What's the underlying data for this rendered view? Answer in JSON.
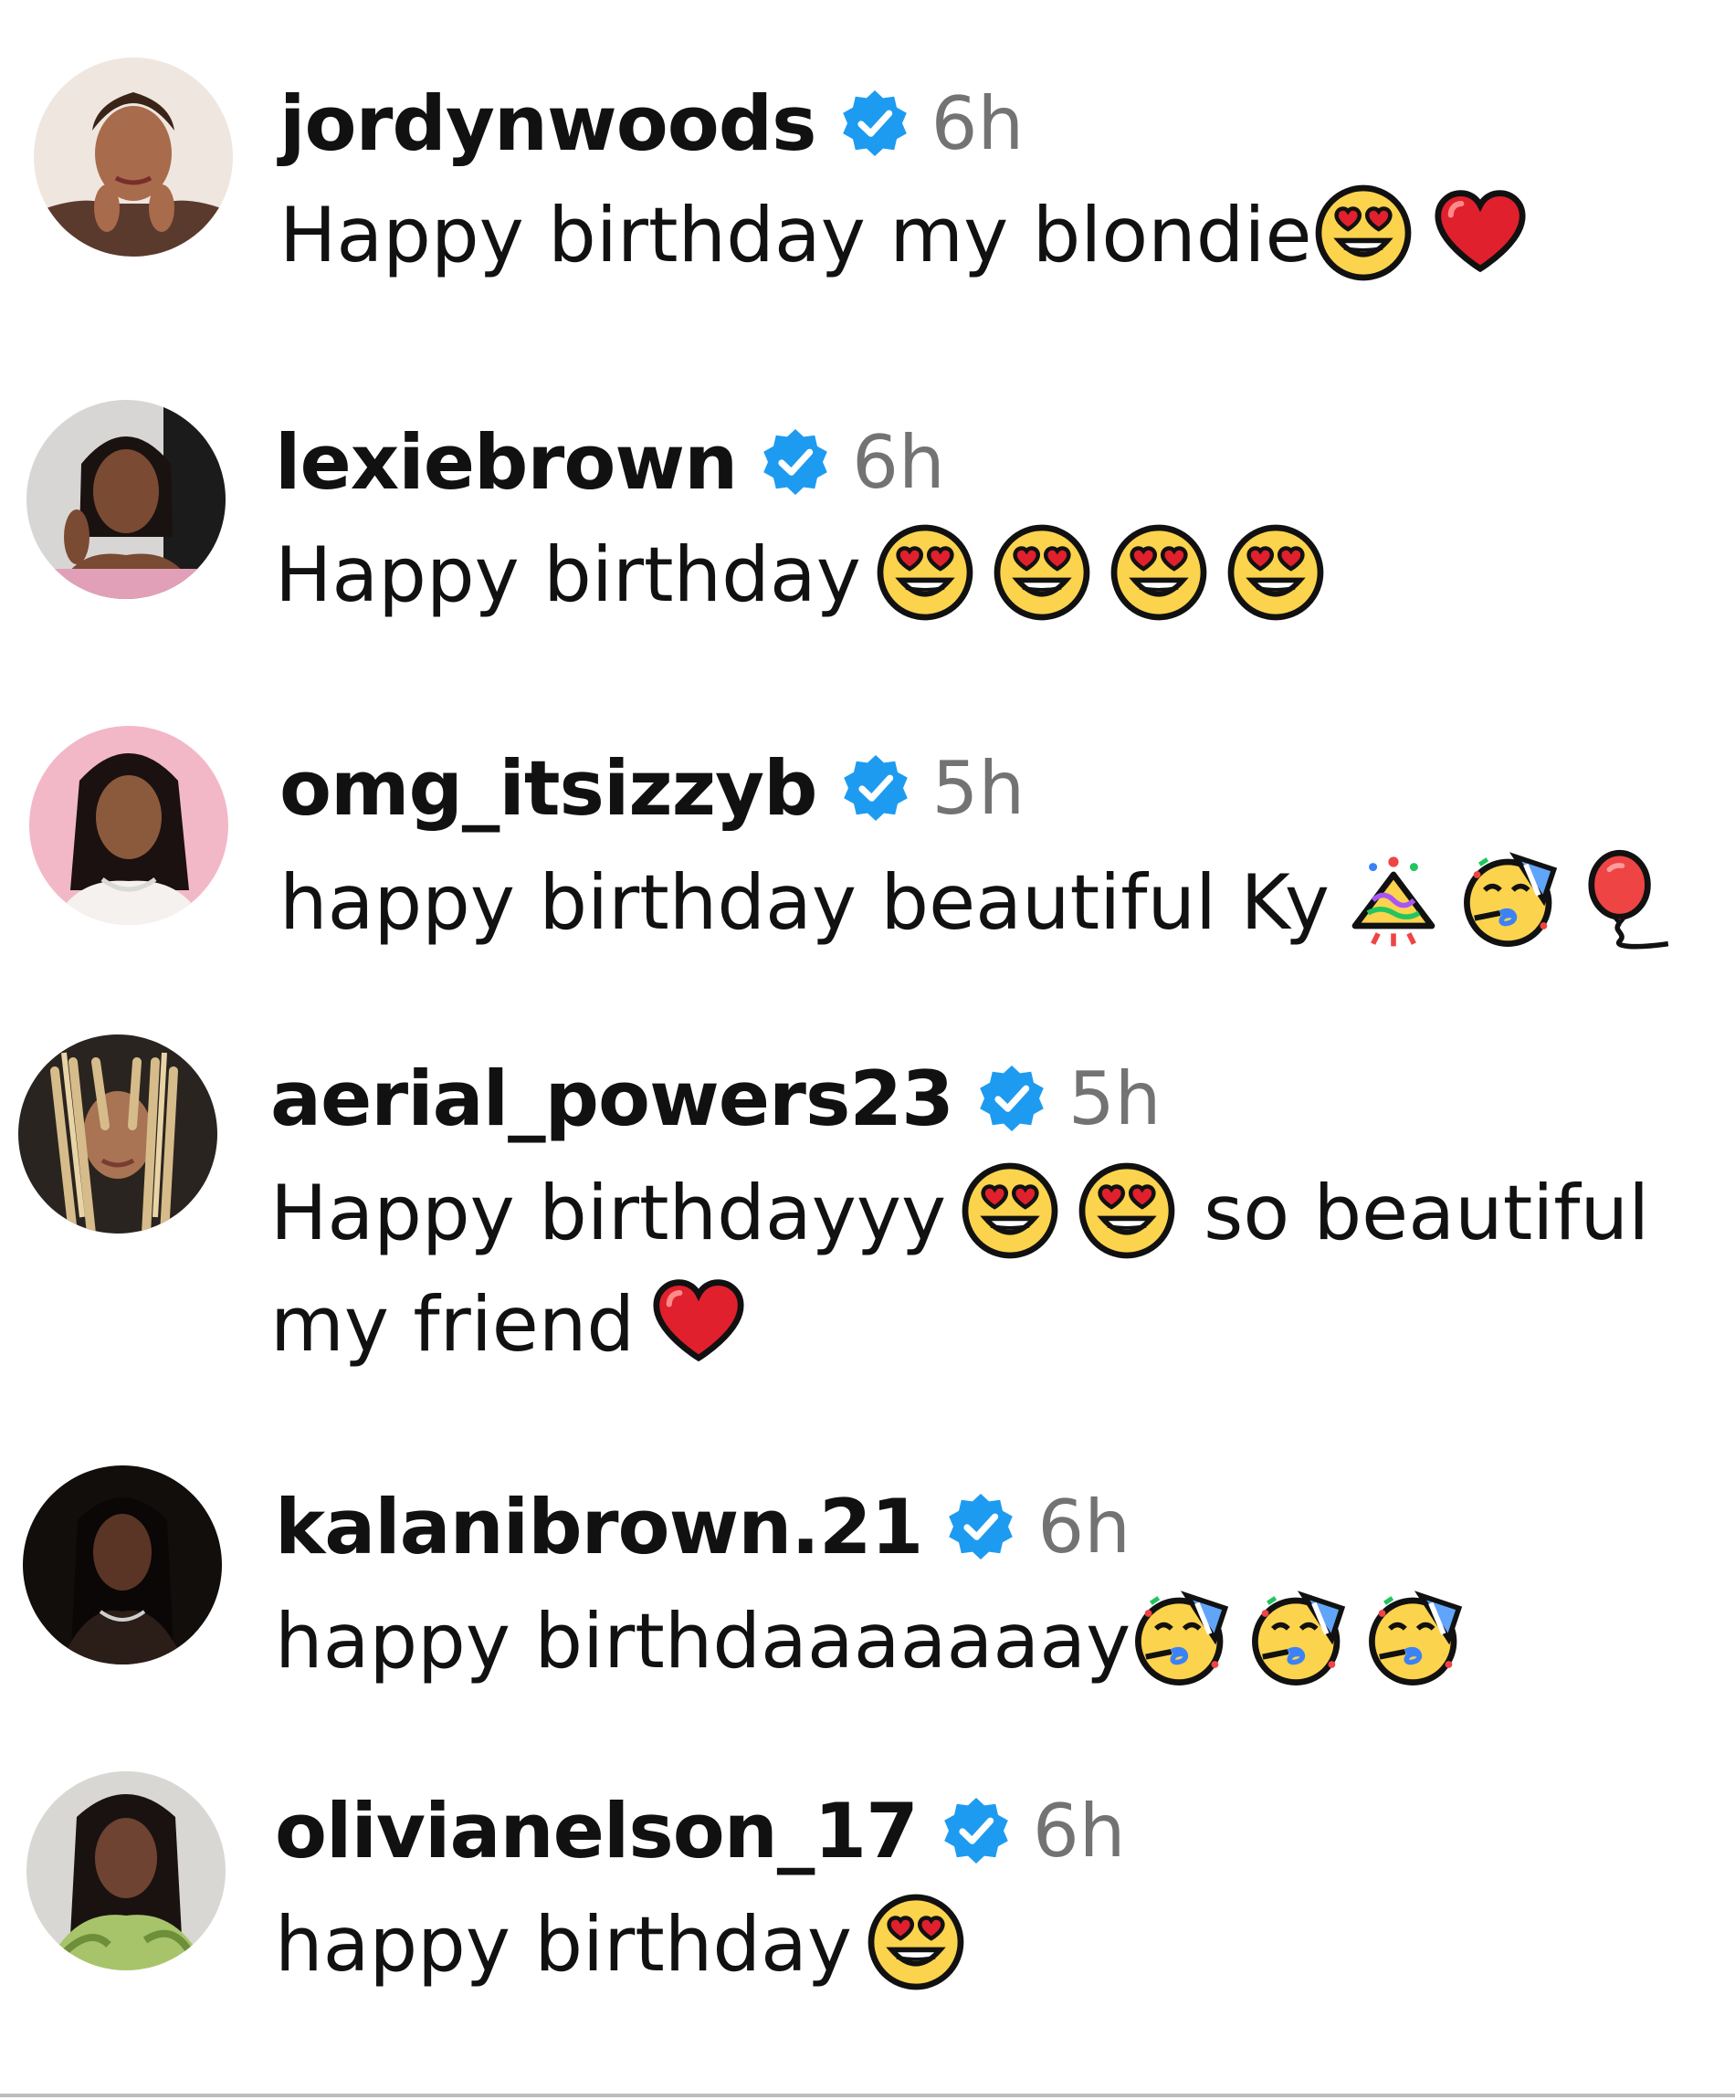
{
  "comments": [
    {
      "username": "jordynwoods",
      "time": "6h",
      "text_before": "Happy birthday my blondie",
      "emojis": [
        "heart-eyes-emoji",
        "red-heart-emoji"
      ],
      "text_after": "",
      "text_line2": ""
    },
    {
      "username": "lexiebrown",
      "time": "6h",
      "text_before": "Happy birthday",
      "emojis": [
        "heart-eyes-emoji",
        "heart-eyes-emoji",
        "heart-eyes-emoji",
        "heart-eyes-emoji"
      ],
      "text_after": "",
      "text_line2": ""
    },
    {
      "username": "omg_itsizzyb",
      "time": "5h",
      "text_before": "happy birthday beautiful Ky",
      "emojis": [
        "party-popper-emoji",
        "partying-face-emoji",
        "balloon-emoji"
      ],
      "text_after": "",
      "text_line2": ""
    },
    {
      "username": "aerial_powers23",
      "time": "5h",
      "text_before": "Happy birthdayyy",
      "emojis": [
        "heart-eyes-emoji",
        "heart-eyes-emoji"
      ],
      "text_after": "so beautiful",
      "text_line2": "my friend",
      "line2_emojis": [
        "red-heart-emoji"
      ]
    },
    {
      "username": "kalanibrown.21",
      "time": "6h",
      "text_before": "happy birthdaaaaaaay",
      "emojis": [
        "partying-face-emoji",
        "partying-face-emoji",
        "partying-face-emoji"
      ],
      "text_after": "",
      "text_line2": ""
    },
    {
      "username": "olivianelson_17",
      "time": "6h",
      "text_before": "happy birthday",
      "emojis": [
        "heart-eyes-emoji"
      ],
      "text_after": "",
      "text_line2": ""
    }
  ],
  "colors": {
    "verified_badge": "#1d9bf0",
    "time_text": "#737373",
    "heart_red": "#e0202c",
    "emoji_yellow": "#fcd34d"
  }
}
